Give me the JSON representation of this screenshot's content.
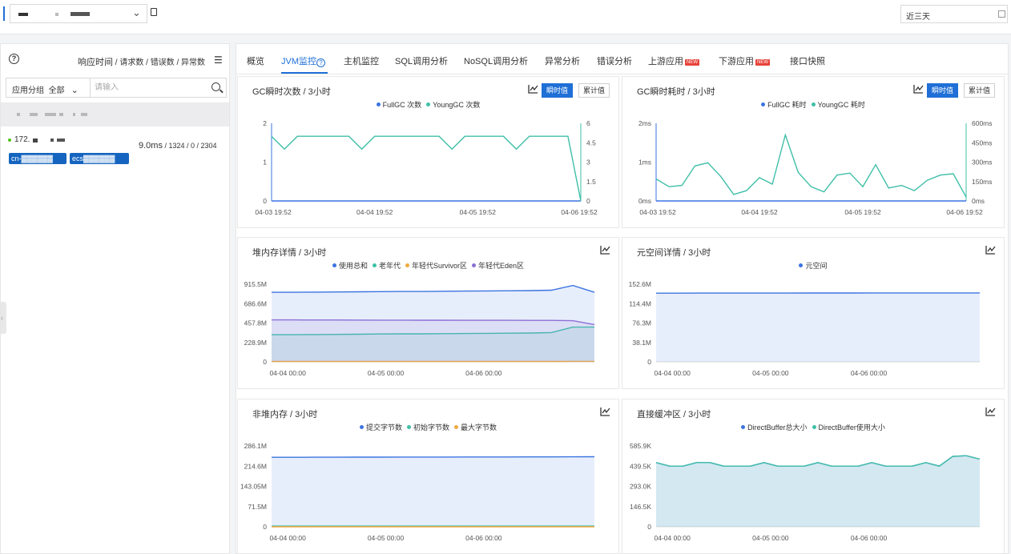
{
  "topbar": {
    "range_label": "近三天"
  },
  "left": {
    "sort_label_main": "响应时间",
    "sort_sep": " / ",
    "sort_requests": "请求数",
    "sort_errors": "错误数",
    "sort_exceptions": "异常数",
    "group_label": "应用分组",
    "group_value": "全部",
    "search_placeholder": "请输入",
    "instance": {
      "ip": "172.",
      "metrics_main": "9.0ms",
      "metrics_rest": " / 1324 / 0 / 2304",
      "tag1": "cn-",
      "tag2": "ecs"
    }
  },
  "tabs": [
    {
      "label": "概览"
    },
    {
      "label": "JVM监控"
    },
    {
      "label": "主机监控"
    },
    {
      "label": "SQL调用分析"
    },
    {
      "label": "NoSQL调用分析"
    },
    {
      "label": "异常分析"
    },
    {
      "label": "错误分析"
    },
    {
      "label": "上游应用"
    },
    {
      "label": "下游应用"
    },
    {
      "label": "接口快照"
    }
  ],
  "badge_new": "NEW",
  "buttons": {
    "instant": "瞬时值",
    "cumulative": "累计值"
  },
  "colors": {
    "blue": "#3b74e0",
    "teal": "#3fbfa8",
    "orange": "#f2a940",
    "purple": "#8b6fd6",
    "accent": "#1f6fd6"
  },
  "chart_data": [
    {
      "id": "gc_count",
      "type": "line",
      "title": "GC瞬时次数 / 3小时",
      "x_ticks": [
        "04-03 19:52",
        "04-04 19:52",
        "04-05 19:52",
        "04-06 19:52"
      ],
      "y_left_ticks": [
        "0",
        "1",
        "2"
      ],
      "y_right_ticks": [
        "0",
        "1.5",
        "3",
        "4.5",
        "6"
      ],
      "ylim_left": [
        0,
        2
      ],
      "ylim_right": [
        0,
        6
      ],
      "series": [
        {
          "name": "FullGC 次数",
          "color": "#3b74e0",
          "axis": "left",
          "values": [
            0,
            0,
            0,
            0,
            0,
            0,
            0,
            0,
            0,
            0,
            0,
            0,
            0,
            0,
            0,
            0,
            0,
            0,
            0,
            0,
            0,
            0,
            0,
            0,
            0
          ]
        },
        {
          "name": "YoungGC 次数",
          "color": "#3fbfa8",
          "axis": "right",
          "values": [
            5,
            4,
            5,
            5,
            5,
            5,
            5,
            4,
            5,
            5,
            5,
            5,
            5,
            5,
            4,
            5,
            5,
            5,
            5,
            4,
            5,
            5,
            5,
            5,
            0
          ]
        }
      ]
    },
    {
      "id": "gc_time",
      "type": "line",
      "title": "GC瞬时耗时 / 3小时",
      "x_ticks": [
        "04-03 19:52",
        "04-04 19:52",
        "04-05 19:52",
        "04-06 19:52"
      ],
      "y_left_ticks": [
        "0ms",
        "1ms",
        "2ms"
      ],
      "y_right_ticks": [
        "0ms",
        "150ms",
        "300ms",
        "450ms",
        "600ms"
      ],
      "ylim_left": [
        0,
        2
      ],
      "ylim_right": [
        0,
        600
      ],
      "series": [
        {
          "name": "FullGC 耗时",
          "color": "#3b74e0",
          "axis": "left",
          "values": [
            0,
            0,
            0,
            0,
            0,
            0,
            0,
            0,
            0,
            0,
            0,
            0,
            0,
            0,
            0,
            0,
            0,
            0,
            0,
            0,
            0,
            0,
            0,
            0,
            0
          ]
        },
        {
          "name": "YoungGC 耗时",
          "color": "#3fbfa8",
          "axis": "right",
          "values": [
            170,
            110,
            120,
            270,
            295,
            190,
            50,
            80,
            180,
            130,
            510,
            220,
            110,
            70,
            200,
            215,
            110,
            280,
            100,
            120,
            80,
            160,
            200,
            210,
            30
          ]
        }
      ]
    },
    {
      "id": "heap",
      "type": "area",
      "title": "堆内存详情 / 3小时",
      "x_ticks": [
        "04-04 00:00",
        "04-05 00:00",
        "04-06 00:00"
      ],
      "y_ticks": [
        "0",
        "228.9M",
        "457.8M",
        "686.6M",
        "915.5M"
      ],
      "ylim": [
        0,
        915.5
      ],
      "series": [
        {
          "name": "使用总和",
          "color": "#3b74e0",
          "values": [
            820,
            820,
            822,
            824,
            826,
            828,
            830,
            830,
            832,
            834,
            836,
            838,
            840,
            845,
            900,
            820
          ]
        },
        {
          "name": "老年代",
          "color": "#3fbfa8",
          "values": [
            320,
            320,
            322,
            324,
            326,
            328,
            330,
            330,
            332,
            334,
            336,
            338,
            340,
            345,
            410,
            410
          ]
        },
        {
          "name": "年轻代Survivor区",
          "color": "#f2a940",
          "values": [
            5,
            5,
            5,
            5,
            5,
            5,
            5,
            5,
            5,
            5,
            5,
            5,
            5,
            5,
            6,
            6
          ]
        },
        {
          "name": "年轻代Eden区",
          "color": "#8b6fd6",
          "values": [
            495,
            495,
            494,
            494,
            493,
            492,
            492,
            491,
            491,
            490,
            490,
            490,
            489,
            489,
            485,
            440
          ]
        }
      ]
    },
    {
      "id": "metaspace",
      "type": "area",
      "title": "元空间详情 / 3小时",
      "x_ticks": [
        "04-04 00:00",
        "04-05 00:00",
        "04-06 00:00"
      ],
      "y_ticks": [
        "0",
        "38.1M",
        "76.3M",
        "114.4M",
        "152.6M"
      ],
      "ylim": [
        0,
        152.6
      ],
      "series": [
        {
          "name": "元空间",
          "color": "#3b74e0",
          "values": [
            135,
            135,
            135.1,
            135.1,
            135.2,
            135.2,
            135.2,
            135.3,
            135.3,
            135.3,
            135.4,
            135.4,
            135.4,
            135.5,
            135.5,
            135.5
          ]
        }
      ]
    },
    {
      "id": "nonheap",
      "type": "area",
      "title": "非堆内存 / 3小时",
      "x_ticks": [
        "04-04 00:00",
        "04-05 00:00",
        "04-06 00:00"
      ],
      "y_ticks": [
        "0",
        "71.5M",
        "143.05M",
        "214.6M",
        "286.1M"
      ],
      "ylim": [
        0,
        286.1
      ],
      "series": [
        {
          "name": "提交字节数",
          "color": "#3b74e0",
          "values": [
            246,
            246,
            246.2,
            246.3,
            246.4,
            246.5,
            246.6,
            246.7,
            246.8,
            246.9,
            247,
            247.1,
            247.2,
            247.4,
            247.6,
            248
          ]
        },
        {
          "name": "初始字节数",
          "color": "#3fbfa8",
          "values": [
            2.5,
            2.5,
            2.5,
            2.5,
            2.5,
            2.5,
            2.5,
            2.5,
            2.5,
            2.5,
            2.5,
            2.5,
            2.5,
            2.5,
            2.5,
            2.5
          ]
        },
        {
          "name": "最大字节数",
          "color": "#f2a940",
          "values": [
            0,
            0,
            0,
            0,
            0,
            0,
            0,
            0,
            0,
            0,
            0,
            0,
            0,
            0,
            0,
            0
          ]
        }
      ]
    },
    {
      "id": "direct",
      "type": "area",
      "title": "直接缓冲区 / 3小时",
      "x_ticks": [
        "04-04 00:00",
        "04-05 00:00",
        "04-06 00:00"
      ],
      "y_ticks": [
        "0",
        "146.5K",
        "293.0K",
        "439.5K",
        "585.9K"
      ],
      "ylim": [
        0,
        585.9
      ],
      "series": [
        {
          "name": "DirectBuffer总大小",
          "color": "#3b74e0",
          "values": [
            465,
            440,
            440,
            465,
            465,
            440,
            440,
            440,
            465,
            440,
            440,
            440,
            465,
            440,
            440,
            440,
            465,
            440,
            440,
            440,
            465,
            440,
            510,
            515,
            490
          ]
        },
        {
          "name": "DirectBuffer使用大小",
          "color": "#3fbfa8",
          "values": [
            465,
            440,
            440,
            465,
            465,
            440,
            440,
            440,
            465,
            440,
            440,
            440,
            465,
            440,
            440,
            440,
            465,
            440,
            440,
            440,
            465,
            440,
            510,
            515,
            490
          ]
        }
      ]
    }
  ]
}
